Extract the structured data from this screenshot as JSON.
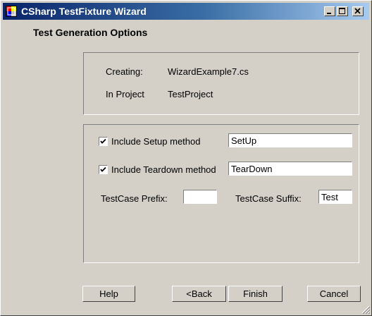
{
  "window": {
    "title": "CSharp TestFixture Wizard"
  },
  "page": {
    "heading": "Test Generation Options"
  },
  "info": {
    "creating_label": "Creating:",
    "creating_value": "WizardExample7.cs",
    "project_label": "In Project",
    "project_value": "TestProject"
  },
  "options": {
    "setup_label": "Include Setup method",
    "setup_checked": true,
    "setup_value": "SetUp",
    "teardown_label": "Include Teardown method",
    "teardown_checked": true,
    "teardown_value": "TearDown",
    "prefix_label": "TestCase Prefix:",
    "prefix_value": "",
    "suffix_label": "TestCase Suffix:",
    "suffix_value": "Test"
  },
  "buttons": {
    "help": "Help",
    "back": "<Back",
    "finish": "Finish",
    "cancel": "Cancel"
  },
  "colors": {
    "title_gradient_start": "#0a246a",
    "title_gradient_end": "#a6caf0",
    "face": "#d4d0c8"
  },
  "icons": [
    "app-icon",
    "minimize-icon",
    "maximize-icon",
    "close-icon",
    "checkmark-icon",
    "resize-grip-icon"
  ]
}
